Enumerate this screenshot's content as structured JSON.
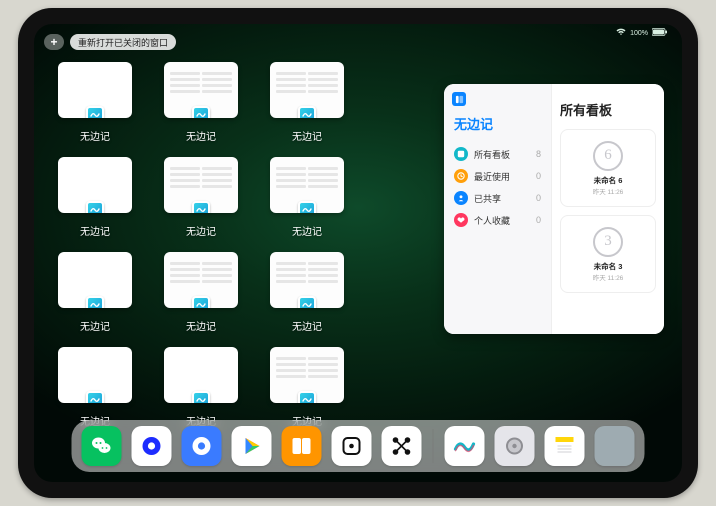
{
  "status": {
    "wifi": "wifi-icon",
    "battery_pct": "100%"
  },
  "topbar": {
    "plus": "+",
    "reopen_label": "重新打开已关闭的窗口"
  },
  "window_tiles": [
    {
      "type": "blank",
      "label": "无边记"
    },
    {
      "type": "board",
      "label": "无边记"
    },
    {
      "type": "board",
      "label": "无边记"
    },
    {
      "type": "blank",
      "label": "无边记"
    },
    {
      "type": "board",
      "label": "无边记"
    },
    {
      "type": "board",
      "label": "无边记"
    },
    {
      "type": "blank",
      "label": "无边记"
    },
    {
      "type": "board",
      "label": "无边记"
    },
    {
      "type": "board",
      "label": "无边记"
    },
    {
      "type": "blank",
      "label": "无边记"
    },
    {
      "type": "blank",
      "label": "无边记"
    },
    {
      "type": "board",
      "label": "无边记"
    }
  ],
  "tile_layout": [
    [
      0,
      1,
      2
    ],
    [
      3,
      4,
      5
    ],
    [
      6,
      7,
      8
    ],
    [
      9,
      10,
      11
    ]
  ],
  "open_window": {
    "more": "···",
    "left_title": "无边记",
    "items": [
      {
        "icon_color": "#12b8c9",
        "name": "所有看板",
        "count": "8"
      },
      {
        "icon_color": "#ff9f0a",
        "name": "最近使用",
        "count": "0"
      },
      {
        "icon_color": "#0a84ff",
        "name": "已共享",
        "count": "0"
      },
      {
        "icon_color": "#ff375f",
        "name": "个人收藏",
        "count": "0"
      }
    ],
    "right_title": "所有看板",
    "boards": [
      {
        "scribble": "6",
        "name": "未命名 6",
        "time": "昨天 11:26"
      },
      {
        "scribble": "3",
        "name": "未命名 3",
        "time": "昨天 11:26"
      }
    ]
  },
  "dock": {
    "apps": [
      {
        "name": "wechat",
        "bg": "#07c160",
        "glyph": "chat"
      },
      {
        "name": "quark-hd",
        "bg": "#ffffff",
        "glyph": "donut-blue"
      },
      {
        "name": "quark",
        "bg": "#3a7bff",
        "glyph": "donut-white"
      },
      {
        "name": "play",
        "bg": "#ffffff",
        "glyph": "play"
      },
      {
        "name": "books",
        "bg": "#ff9500",
        "glyph": "book"
      },
      {
        "name": "dice",
        "bg": "#ffffff",
        "glyph": "die"
      },
      {
        "name": "connect",
        "bg": "#ffffff",
        "glyph": "nodes"
      }
    ],
    "recent": [
      {
        "name": "freeform",
        "bg": "#ffffff",
        "glyph": "wave"
      },
      {
        "name": "settings",
        "bg": "#e5e5ea",
        "glyph": "gear"
      },
      {
        "name": "notes",
        "bg": "#ffffff",
        "glyph": "notes"
      }
    ],
    "folder": {
      "name": "app-folder"
    }
  }
}
